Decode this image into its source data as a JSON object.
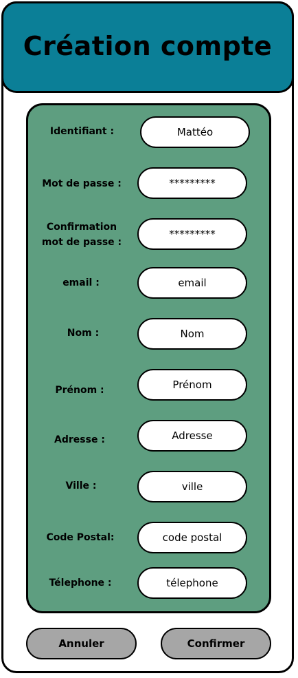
{
  "header": {
    "title": "Création compte"
  },
  "form": {
    "fields": [
      {
        "label": "Identifiant :",
        "value": "Mattéo"
      },
      {
        "label": "Mot de passe :",
        "value": "*********"
      },
      {
        "label_line1": "Confirmation",
        "label_line2": "mot de passe :",
        "value": "*********"
      },
      {
        "label": "email :",
        "value": "email"
      },
      {
        "label": "Nom :",
        "value": "Nom"
      },
      {
        "label": "Prénom :",
        "value": "Prénom"
      },
      {
        "label": "Adresse :",
        "value": "Adresse"
      },
      {
        "label": "Ville :",
        "value": "ville"
      },
      {
        "label": "Code Postal:",
        "value": "code postal"
      },
      {
        "label": "Télephone :",
        "value": "télephone"
      }
    ]
  },
  "actions": {
    "cancel_label": "Annuler",
    "confirm_label": "Confirmer"
  },
  "colors": {
    "header": "#0b7f97",
    "panel": "#5e9e80",
    "button": "#a6a6a6"
  }
}
